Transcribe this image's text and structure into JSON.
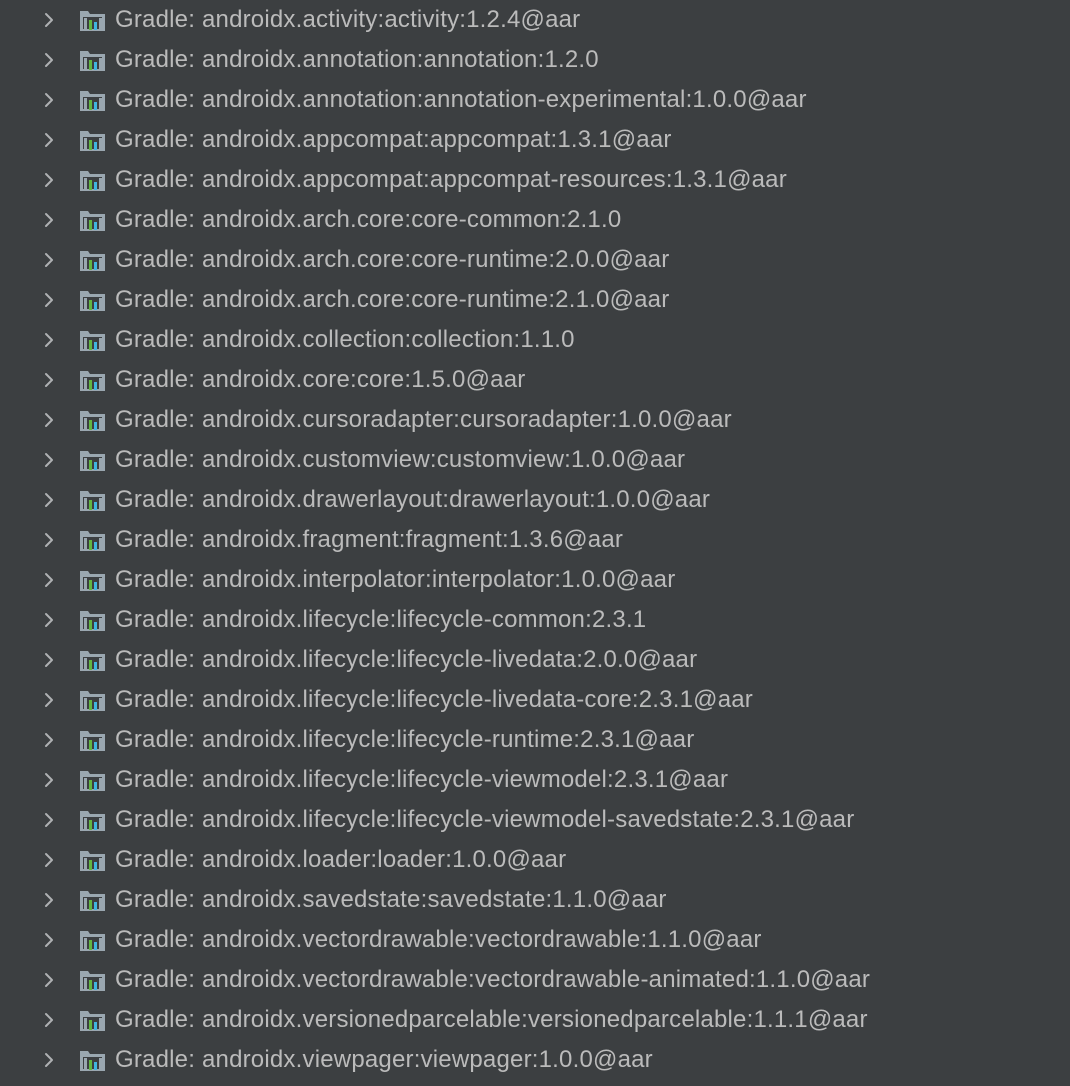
{
  "tree": {
    "items": [
      {
        "label": "Gradle: androidx.activity:activity:1.2.4@aar"
      },
      {
        "label": "Gradle: androidx.annotation:annotation:1.2.0"
      },
      {
        "label": "Gradle: androidx.annotation:annotation-experimental:1.0.0@aar"
      },
      {
        "label": "Gradle: androidx.appcompat:appcompat:1.3.1@aar"
      },
      {
        "label": "Gradle: androidx.appcompat:appcompat-resources:1.3.1@aar"
      },
      {
        "label": "Gradle: androidx.arch.core:core-common:2.1.0"
      },
      {
        "label": "Gradle: androidx.arch.core:core-runtime:2.0.0@aar"
      },
      {
        "label": "Gradle: androidx.arch.core:core-runtime:2.1.0@aar"
      },
      {
        "label": "Gradle: androidx.collection:collection:1.1.0"
      },
      {
        "label": "Gradle: androidx.core:core:1.5.0@aar"
      },
      {
        "label": "Gradle: androidx.cursoradapter:cursoradapter:1.0.0@aar"
      },
      {
        "label": "Gradle: androidx.customview:customview:1.0.0@aar"
      },
      {
        "label": "Gradle: androidx.drawerlayout:drawerlayout:1.0.0@aar"
      },
      {
        "label": "Gradle: androidx.fragment:fragment:1.3.6@aar"
      },
      {
        "label": "Gradle: androidx.interpolator:interpolator:1.0.0@aar"
      },
      {
        "label": "Gradle: androidx.lifecycle:lifecycle-common:2.3.1"
      },
      {
        "label": "Gradle: androidx.lifecycle:lifecycle-livedata:2.0.0@aar"
      },
      {
        "label": "Gradle: androidx.lifecycle:lifecycle-livedata-core:2.3.1@aar"
      },
      {
        "label": "Gradle: androidx.lifecycle:lifecycle-runtime:2.3.1@aar"
      },
      {
        "label": "Gradle: androidx.lifecycle:lifecycle-viewmodel:2.3.1@aar"
      },
      {
        "label": "Gradle: androidx.lifecycle:lifecycle-viewmodel-savedstate:2.3.1@aar"
      },
      {
        "label": "Gradle: androidx.loader:loader:1.0.0@aar"
      },
      {
        "label": "Gradle: androidx.savedstate:savedstate:1.1.0@aar"
      },
      {
        "label": "Gradle: androidx.vectordrawable:vectordrawable:1.1.0@aar"
      },
      {
        "label": "Gradle: androidx.vectordrawable:vectordrawable-animated:1.1.0@aar"
      },
      {
        "label": "Gradle: androidx.versionedparcelable:versionedparcelable:1.1.1@aar"
      },
      {
        "label": "Gradle: androidx.viewpager:viewpager:1.0.0@aar"
      }
    ]
  },
  "icons": {
    "expand": "chevron-right-icon",
    "library": "library-icon"
  },
  "colors": {
    "background": "#3c3f41",
    "text": "#bbbbbb",
    "chevron": "#afb1b3",
    "library_icon_gray": "#9aa7b0",
    "library_icon_green": "#62b543",
    "library_icon_blue": "#40b6e0"
  }
}
